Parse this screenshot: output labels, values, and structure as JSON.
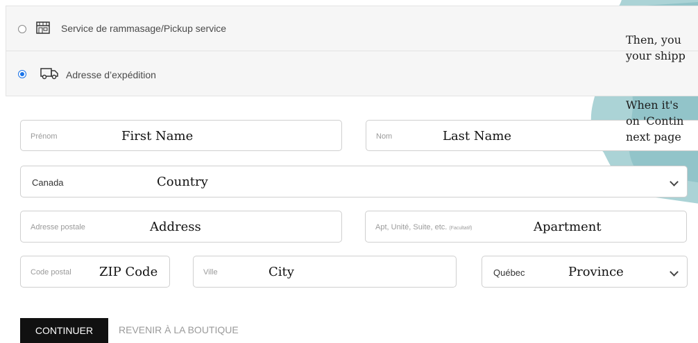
{
  "shipping_options": [
    {
      "label": "Service de rammasage/Pickup service",
      "selected": false,
      "icon": "store-icon"
    },
    {
      "label": "Adresse d’expédition",
      "selected": true,
      "icon": "truck-icon"
    }
  ],
  "form": {
    "first_name": {
      "placeholder": "Prénom",
      "annotation": "First Name"
    },
    "last_name": {
      "placeholder": "Nom",
      "annotation": "Last Name"
    },
    "country": {
      "value": "Canada",
      "annotation": "Country"
    },
    "address": {
      "placeholder": "Adresse postale",
      "annotation": "Address"
    },
    "apartment": {
      "placeholder": "Apt, Unité, Suite, etc.",
      "optional": "(Facultatif)",
      "annotation": "Apartment"
    },
    "postal_code": {
      "placeholder": "Code postal",
      "annotation": "ZIP Code"
    },
    "city": {
      "placeholder": "Ville",
      "annotation": "City"
    },
    "province": {
      "value": "Québec",
      "annotation": "Province"
    }
  },
  "actions": {
    "continue": "CONTINUER",
    "back": "REVENIR À LA BOUTIQUE"
  },
  "tip": {
    "line1": "Then, you",
    "line2": "your shipp",
    "line3": "When it's",
    "line4": "on 'Contin",
    "line5": "next page"
  },
  "colors": {
    "accent": "#1a73e8",
    "paint": "#8fc4c8",
    "button": "#111111"
  }
}
